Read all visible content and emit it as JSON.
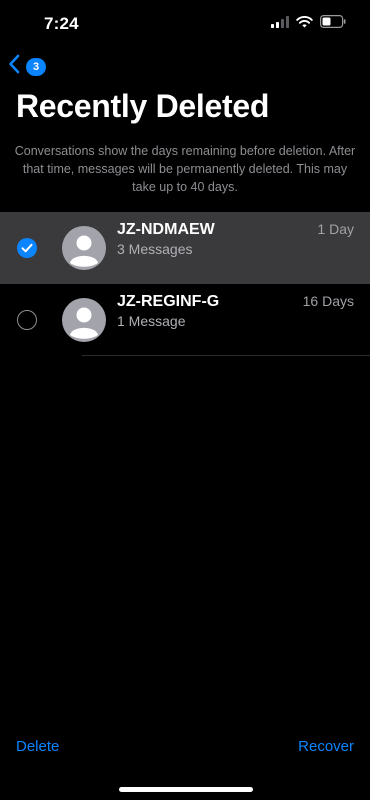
{
  "status_bar": {
    "time": "7:24",
    "icons": [
      "cellular-signal-icon",
      "wifi-icon",
      "battery-icon"
    ]
  },
  "nav": {
    "back_icon": "chevron-left-icon",
    "badge_count": "3"
  },
  "page": {
    "title": "Recently Deleted",
    "description": "Conversations show the days remaining before deletion. After that time, messages will be permanently deleted. This may take up to 40 days."
  },
  "conversations": [
    {
      "name": "JZ-NDMAEW",
      "message_count": "3 Messages",
      "days_remaining": "1 Day",
      "selected": true
    },
    {
      "name": "JZ-REGINF-G",
      "message_count": "1 Message",
      "days_remaining": "16 Days",
      "selected": false
    }
  ],
  "toolbar": {
    "delete_label": "Delete",
    "recover_label": "Recover"
  },
  "colors": {
    "accent": "#0a84ff",
    "background": "#000000",
    "selected_row": "#3a3a3c",
    "secondary_text": "#8e8e93"
  }
}
